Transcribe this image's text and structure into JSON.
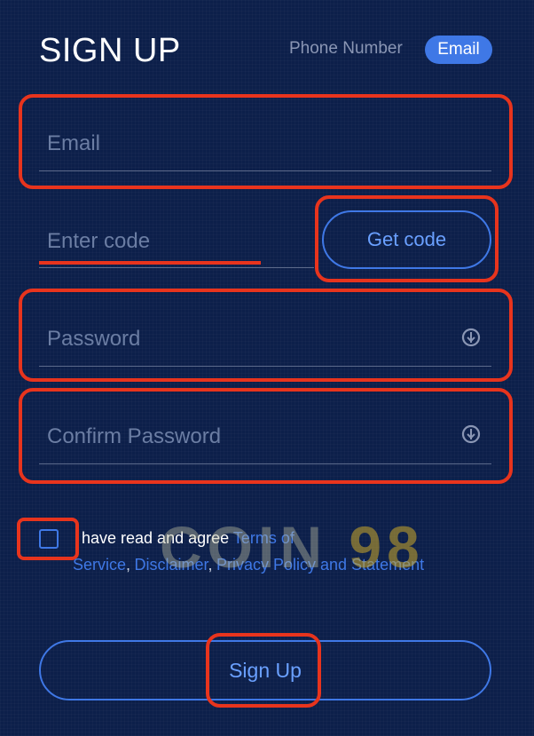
{
  "header": {
    "title": "SIGN UP",
    "tabs": [
      {
        "label": "Phone Number",
        "active": false
      },
      {
        "label": "Email",
        "active": true
      }
    ]
  },
  "form": {
    "email_placeholder": "Email",
    "code_placeholder": "Enter code",
    "get_code_label": "Get code",
    "password_placeholder": "Password",
    "confirm_password_placeholder": "Confirm Password"
  },
  "agreement": {
    "checked": false,
    "prefix": "have read and agree",
    "terms_link_part1": "Terms of",
    "terms_link_part2": "Service",
    "separator1": ",",
    "disclaimer_link": "Disclaimer",
    "separator2": ",",
    "privacy_link": "Privacy Policy and Statement"
  },
  "submit_label": "Sign Up",
  "watermark": {
    "text": "COIN",
    "number": "98"
  },
  "colors": {
    "background": "#0c1f4a",
    "accent": "#3f78e6",
    "highlight": "#e8341d",
    "placeholder": "#6b7da3"
  },
  "icons": {
    "eye_toggle": "eye-hidden-icon"
  }
}
